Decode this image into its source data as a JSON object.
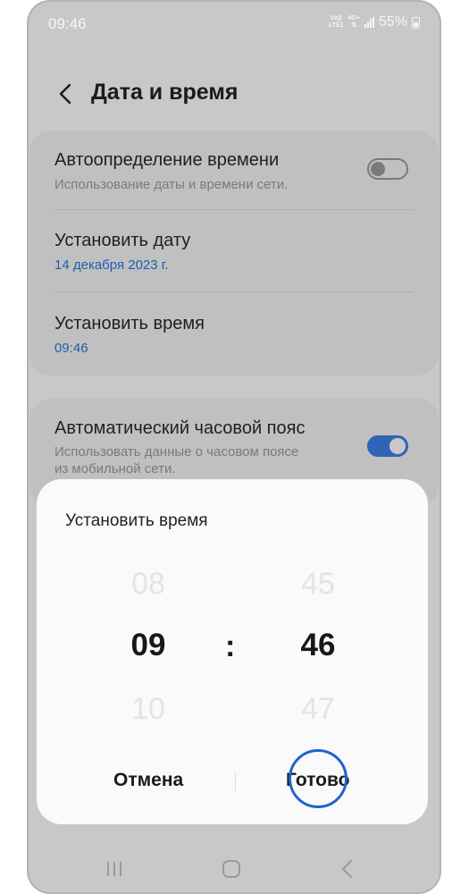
{
  "status_bar": {
    "time": "09:46",
    "network_top": "Vo))",
    "network_bottom": "LTE1",
    "data_type": "4G+",
    "battery": "55%"
  },
  "header": {
    "title": "Дата и время",
    "back_icon": "chevron-left-icon"
  },
  "settings": {
    "auto_time": {
      "title": "Автоопределение времени",
      "subtitle": "Использование даты и времени сети.",
      "enabled": false
    },
    "set_date": {
      "title": "Установить дату",
      "value": "14 декабря 2023 г."
    },
    "set_time": {
      "title": "Установить время",
      "value": "09:46"
    },
    "auto_timezone": {
      "title": "Автоматический часовой пояс",
      "subtitle_line1": "Использовать данные о часовом поясе",
      "subtitle_line2": "из мобильной сети.",
      "enabled": true
    }
  },
  "dialog": {
    "title": "Установить время",
    "hours": {
      "prev": "08",
      "selected": "09",
      "next": "10"
    },
    "separator": ":",
    "minutes": {
      "prev": "45",
      "selected": "46",
      "next": "47"
    },
    "cancel_label": "Отмена",
    "done_label": "Готово"
  },
  "colors": {
    "accent": "#2f63b6",
    "tap_highlight": "#1f63d1",
    "date_value": "#1d5fb1"
  },
  "nav_bar": {
    "icons": [
      "recent-apps-icon",
      "home-icon",
      "back-icon"
    ]
  }
}
